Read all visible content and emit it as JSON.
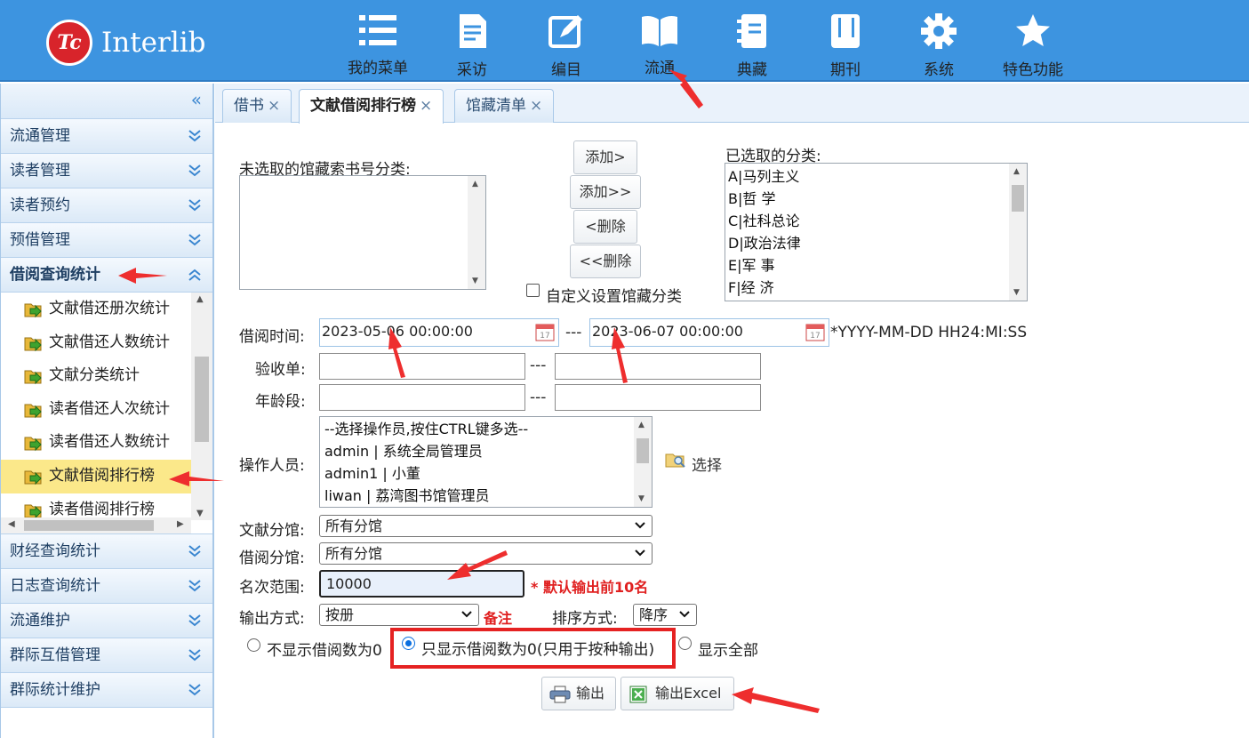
{
  "app": {
    "logo_text": "Interlib",
    "logo_badge": "Tc"
  },
  "nav": [
    {
      "label": "我的菜单",
      "icon": "list-icon"
    },
    {
      "label": "采访",
      "icon": "document-icon"
    },
    {
      "label": "编目",
      "icon": "edit-icon"
    },
    {
      "label": "流通",
      "icon": "open-book-icon"
    },
    {
      "label": "典藏",
      "icon": "notebook-icon"
    },
    {
      "label": "期刊",
      "icon": "journal-icon"
    },
    {
      "label": "系统",
      "icon": "gear-icon"
    },
    {
      "label": "特色功能",
      "icon": "star-icon"
    }
  ],
  "sidebar": {
    "collapse_glyph": "«",
    "groups_top": [
      "流通管理",
      "读者管理",
      "读者预约",
      "预借管理"
    ],
    "active_group": "借阅查询统计",
    "sub_items": [
      "文献借还册次统计",
      "文献借还人数统计",
      "文献分类统计",
      "读者借还人次统计",
      "读者借还人数统计",
      "文献借阅排行榜",
      "读者借阅排行榜"
    ],
    "selected_sub_item": "文献借阅排行榜",
    "groups_bottom": [
      "财经查询统计",
      "日志查询统计",
      "流通维护",
      "群际互借管理",
      "群际统计维护"
    ]
  },
  "tabs": [
    {
      "label": "借书",
      "close": "×"
    },
    {
      "label": "文献借阅排行榜",
      "close": "×",
      "active": true
    },
    {
      "label": "馆藏清单",
      "close": "×"
    }
  ],
  "form": {
    "unselected_label": "未选取的馆藏索书号分类:",
    "selected_label": "已选取的分类:",
    "selected_categories": [
      "A|马列主义",
      "B|哲 学",
      "C|社科总论",
      "D|政治法律",
      "E|军 事",
      "F|经 济"
    ],
    "buttons": {
      "add": "添加>",
      "add_all": "添加>>",
      "remove": "<删除",
      "remove_all": "<<删除"
    },
    "custom_category_label": "自定义设置馆藏分类",
    "borrow_time_label": "借阅时间:",
    "borrow_time_start": "2023-05-06 00:00:00",
    "borrow_time_end": "2023-06-07 00:00:00",
    "range_sep": "---",
    "date_format_hint": "*YYYY-MM-DD HH24:MI:SS",
    "acceptance_label": "验收单:",
    "age_label": "年龄段:",
    "operator_label": "操作人员:",
    "operators": [
      "--选择操作员,按住CTRL键多选--",
      "admin | 系统全局管理员",
      "admin1 | 小董",
      "liwan | 荔湾图书馆管理员"
    ],
    "select_button": "选择",
    "doc_branch_label": "文献分馆:",
    "doc_branch_value": "所有分馆",
    "borrow_branch_label": "借阅分馆:",
    "borrow_branch_value": "所有分馆",
    "rank_range_label": "名次范围:",
    "rank_range_value": "10000",
    "rank_note": "* 默认输出前10名",
    "output_mode_label": "输出方式:",
    "output_mode_value": "按册",
    "remark": "备注",
    "sort_label": "排序方式:",
    "sort_value": "降序",
    "radio_options": [
      "不显示借阅数为0",
      "只显示借阅数为0(只用于按种输出)",
      "显示全部"
    ],
    "radio_selected_index": 1,
    "output_button": "输出",
    "export_excel_button": "输出Excel"
  },
  "colors": {
    "header_bg": "#3d94e0",
    "annotation_red": "#e52222",
    "selected_item": "#fbe88a"
  }
}
